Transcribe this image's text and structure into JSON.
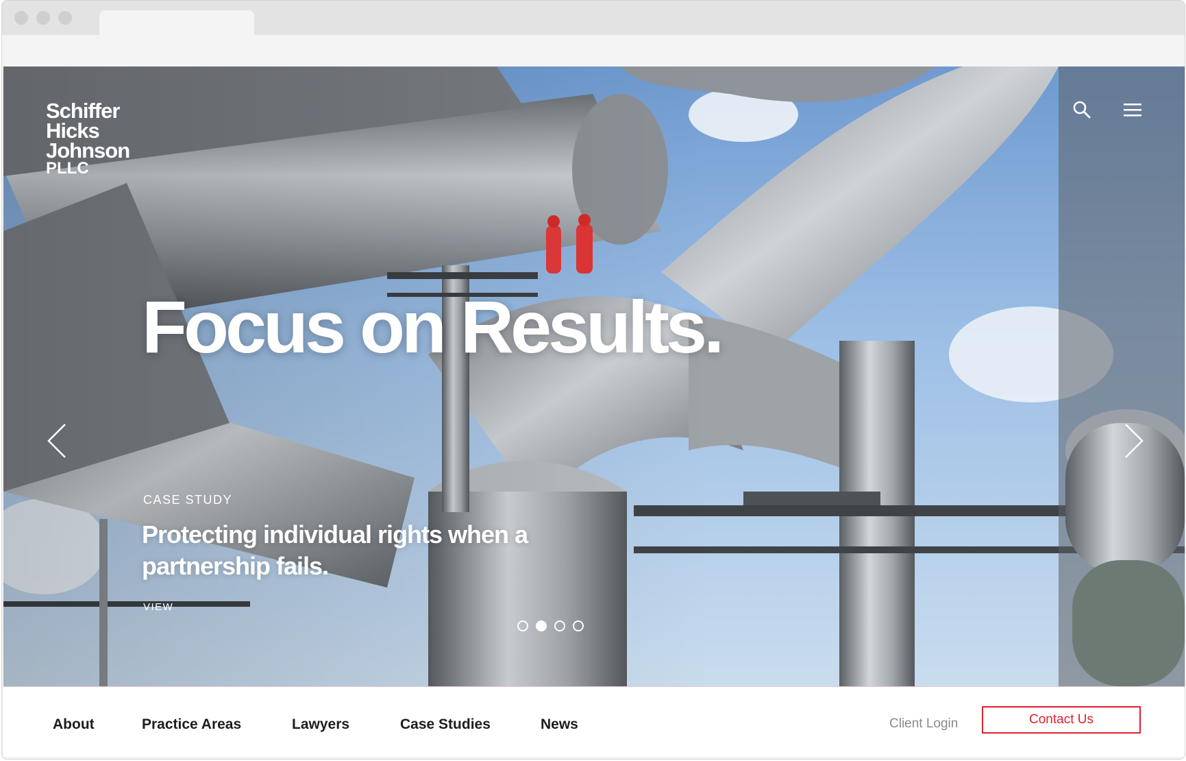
{
  "brand": {
    "logo_lines": [
      "Schiffer",
      "Hicks",
      "Johnson",
      "PLLC"
    ]
  },
  "hero": {
    "headline": "Focus on Results.",
    "case_label": "CASE STUDY",
    "case_title": "Protecting individual rights when a partnership fails.",
    "view_label": "VIEW",
    "slides": {
      "count": 4,
      "active_index": 1
    }
  },
  "nav": {
    "items": [
      "About",
      "Practice Areas",
      "Lawyers",
      "Case Studies",
      "News"
    ],
    "client_login": "Client Login",
    "contact": "Contact Us"
  },
  "colors": {
    "accent": "#e0202e",
    "nav_text": "#1d1d1d",
    "muted_text": "#8a8a8a",
    "sky": "#9ec0e6",
    "pipe": "#a9aeb3"
  },
  "icons": {
    "search": "search-icon",
    "menu": "hamburger-menu-icon",
    "prev": "chevron-left-icon",
    "next": "chevron-right-icon"
  }
}
